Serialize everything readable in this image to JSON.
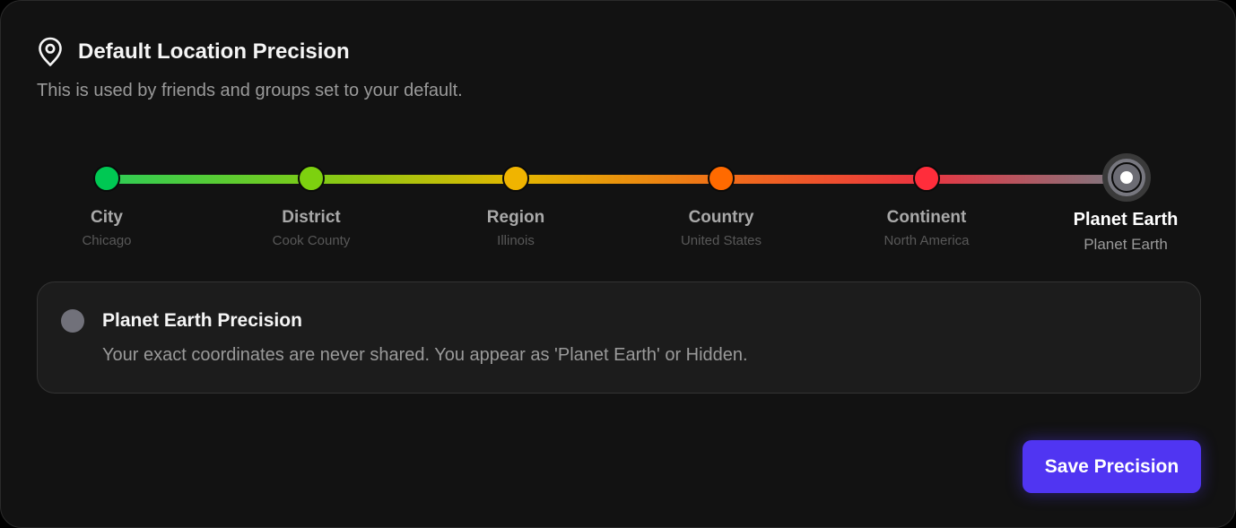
{
  "header": {
    "icon": "map-pin-icon",
    "title": "Default Location Precision",
    "subtitle": "This is used by friends and groups set to your default."
  },
  "precision": {
    "levels": [
      {
        "label": "City",
        "value": "Chicago",
        "color": "#00c853"
      },
      {
        "label": "District",
        "value": "Cook County",
        "color": "#7dd10f"
      },
      {
        "label": "Region",
        "value": "Illinois",
        "color": "#f0b400"
      },
      {
        "label": "Country",
        "value": "United States",
        "color": "#ff6a00"
      },
      {
        "label": "Continent",
        "value": "North America",
        "color": "#ff2d3b"
      },
      {
        "label": "Planet Earth",
        "value": "Planet Earth",
        "color": "#71717a"
      }
    ],
    "selected_index": 5
  },
  "info": {
    "title": "Planet Earth Precision",
    "description": "Your exact coordinates are never shared. You appear as 'Planet Earth' or Hidden.",
    "swatch_color": "#71717a"
  },
  "actions": {
    "save_label": "Save Precision",
    "accent_color": "#5035f2"
  }
}
